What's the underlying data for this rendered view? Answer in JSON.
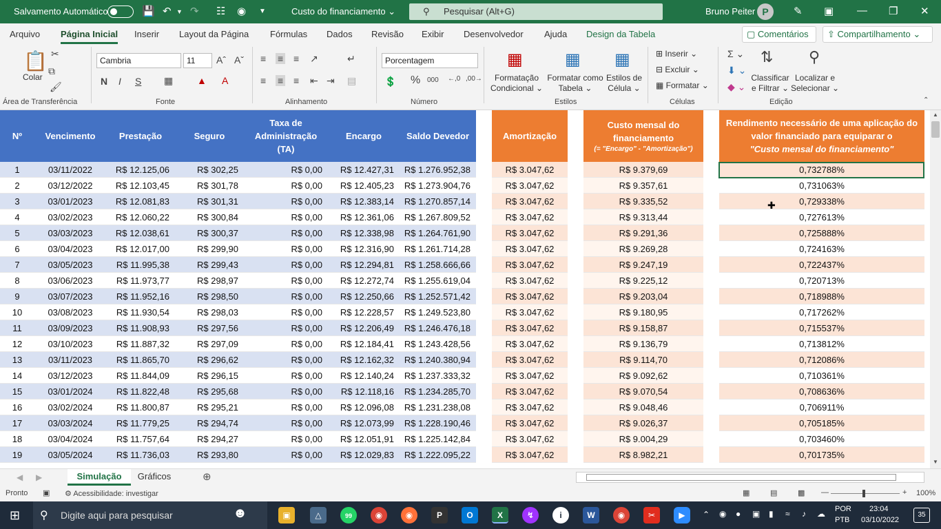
{
  "titlebar": {
    "autosave_label": "Salvamento Automático",
    "file_title": "Custo do financiamento",
    "search_placeholder": "Pesquisar (Alt+G)",
    "user_name": "Bruno Peiter",
    "avatar_initial": "P"
  },
  "menu": {
    "tabs": [
      "Arquivo",
      "Página Inicial",
      "Inserir",
      "Layout da Página",
      "Fórmulas",
      "Dados",
      "Revisão",
      "Exibir",
      "Desenvolvedor",
      "Ajuda",
      "Design da Tabela"
    ],
    "active_tab": "Página Inicial",
    "comments": "Comentários",
    "share": "Compartilhamento"
  },
  "ribbon": {
    "paste": "Colar",
    "font_name": "Cambria",
    "font_size": "11",
    "number_format": "Porcentagem",
    "cond_format": [
      "Formatação",
      "Condicional"
    ],
    "format_table": [
      "Formatar como",
      "Tabela"
    ],
    "cell_styles": [
      "Estilos de",
      "Célula"
    ],
    "insert": "Inserir",
    "delete": "Excluir",
    "format": "Formatar",
    "sort_filter": [
      "Classificar",
      "e Filtrar"
    ],
    "find_select": [
      "Localizar e",
      "Selecionar"
    ],
    "groups": [
      "Área de Transferência",
      "Fonte",
      "Alinhamento",
      "Número",
      "Estilos",
      "Células",
      "Edição"
    ]
  },
  "table_headers": {
    "n": "Nº",
    "vencimento": "Vencimento",
    "prestacao": "Prestação",
    "seguro": "Seguro",
    "taxa": "Taxa de Administração (TA)",
    "encargo": "Encargo",
    "saldo": "Saldo Devedor",
    "amortizacao": "Amortização",
    "custo": "Custo mensal do financiamento",
    "custo_note": "(= \"Encargo\" - \"Amortização\")",
    "rendimento": "Rendimento necessário de uma aplicação do valor financiado para equiparar o",
    "rendimento_italic": "\"Custo mensal do financiamento\""
  },
  "rows": [
    [
      "1",
      "03/11/2022",
      "R$ 12.125,06",
      "R$ 302,25",
      "R$ 0,00",
      "R$ 12.427,31",
      "R$ 1.276.952,38",
      "R$ 3.047,62",
      "R$ 9.379,69",
      "0,732788%"
    ],
    [
      "2",
      "03/12/2022",
      "R$ 12.103,45",
      "R$ 301,78",
      "R$ 0,00",
      "R$ 12.405,23",
      "R$ 1.273.904,76",
      "R$ 3.047,62",
      "R$ 9.357,61",
      "0,731063%"
    ],
    [
      "3",
      "03/01/2023",
      "R$ 12.081,83",
      "R$ 301,31",
      "R$ 0,00",
      "R$ 12.383,14",
      "R$ 1.270.857,14",
      "R$ 3.047,62",
      "R$ 9.335,52",
      "0,729338%"
    ],
    [
      "4",
      "03/02/2023",
      "R$ 12.060,22",
      "R$ 300,84",
      "R$ 0,00",
      "R$ 12.361,06",
      "R$ 1.267.809,52",
      "R$ 3.047,62",
      "R$ 9.313,44",
      "0,727613%"
    ],
    [
      "5",
      "03/03/2023",
      "R$ 12.038,61",
      "R$ 300,37",
      "R$ 0,00",
      "R$ 12.338,98",
      "R$ 1.264.761,90",
      "R$ 3.047,62",
      "R$ 9.291,36",
      "0,725888%"
    ],
    [
      "6",
      "03/04/2023",
      "R$ 12.017,00",
      "R$ 299,90",
      "R$ 0,00",
      "R$ 12.316,90",
      "R$ 1.261.714,28",
      "R$ 3.047,62",
      "R$ 9.269,28",
      "0,724163%"
    ],
    [
      "7",
      "03/05/2023",
      "R$ 11.995,38",
      "R$ 299,43",
      "R$ 0,00",
      "R$ 12.294,81",
      "R$ 1.258.666,66",
      "R$ 3.047,62",
      "R$ 9.247,19",
      "0,722437%"
    ],
    [
      "8",
      "03/06/2023",
      "R$ 11.973,77",
      "R$ 298,97",
      "R$ 0,00",
      "R$ 12.272,74",
      "R$ 1.255.619,04",
      "R$ 3.047,62",
      "R$ 9.225,12",
      "0,720713%"
    ],
    [
      "9",
      "03/07/2023",
      "R$ 11.952,16",
      "R$ 298,50",
      "R$ 0,00",
      "R$ 12.250,66",
      "R$ 1.252.571,42",
      "R$ 3.047,62",
      "R$ 9.203,04",
      "0,718988%"
    ],
    [
      "10",
      "03/08/2023",
      "R$ 11.930,54",
      "R$ 298,03",
      "R$ 0,00",
      "R$ 12.228,57",
      "R$ 1.249.523,80",
      "R$ 3.047,62",
      "R$ 9.180,95",
      "0,717262%"
    ],
    [
      "11",
      "03/09/2023",
      "R$ 11.908,93",
      "R$ 297,56",
      "R$ 0,00",
      "R$ 12.206,49",
      "R$ 1.246.476,18",
      "R$ 3.047,62",
      "R$ 9.158,87",
      "0,715537%"
    ],
    [
      "12",
      "03/10/2023",
      "R$ 11.887,32",
      "R$ 297,09",
      "R$ 0,00",
      "R$ 12.184,41",
      "R$ 1.243.428,56",
      "R$ 3.047,62",
      "R$ 9.136,79",
      "0,713812%"
    ],
    [
      "13",
      "03/11/2023",
      "R$ 11.865,70",
      "R$ 296,62",
      "R$ 0,00",
      "R$ 12.162,32",
      "R$ 1.240.380,94",
      "R$ 3.047,62",
      "R$ 9.114,70",
      "0,712086%"
    ],
    [
      "14",
      "03/12/2023",
      "R$ 11.844,09",
      "R$ 296,15",
      "R$ 0,00",
      "R$ 12.140,24",
      "R$ 1.237.333,32",
      "R$ 3.047,62",
      "R$ 9.092,62",
      "0,710361%"
    ],
    [
      "15",
      "03/01/2024",
      "R$ 11.822,48",
      "R$ 295,68",
      "R$ 0,00",
      "R$ 12.118,16",
      "R$ 1.234.285,70",
      "R$ 3.047,62",
      "R$ 9.070,54",
      "0,708636%"
    ],
    [
      "16",
      "03/02/2024",
      "R$ 11.800,87",
      "R$ 295,21",
      "R$ 0,00",
      "R$ 12.096,08",
      "R$ 1.231.238,08",
      "R$ 3.047,62",
      "R$ 9.048,46",
      "0,706911%"
    ],
    [
      "17",
      "03/03/2024",
      "R$ 11.779,25",
      "R$ 294,74",
      "R$ 0,00",
      "R$ 12.073,99",
      "R$ 1.228.190,46",
      "R$ 3.047,62",
      "R$ 9.026,37",
      "0,705185%"
    ],
    [
      "18",
      "03/04/2024",
      "R$ 11.757,64",
      "R$ 294,27",
      "R$ 0,00",
      "R$ 12.051,91",
      "R$ 1.225.142,84",
      "R$ 3.047,62",
      "R$ 9.004,29",
      "0,703460%"
    ],
    [
      "19",
      "03/05/2024",
      "R$ 11.736,03",
      "R$ 293,80",
      "R$ 0,00",
      "R$ 12.029,83",
      "R$ 1.222.095,22",
      "R$ 3.047,62",
      "R$ 8.982,21",
      "0,701735%"
    ]
  ],
  "sheet_tabs": [
    "Simulação",
    "Gráficos"
  ],
  "active_sheet": "Simulação",
  "status": {
    "ready": "Pronto",
    "accessibility": "Acessibilidade: investigar",
    "zoom": "100%"
  },
  "taskbar": {
    "search_placeholder": "Digite aqui para pesquisar",
    "lang1": "POR",
    "lang2": "PTB",
    "time": "23:04",
    "date": "03/10/2022",
    "notif_count": "35",
    "whatsapp_badge": "99"
  },
  "colors": {
    "excel_green": "#217346",
    "header_blue": "#4472c4",
    "header_orange": "#ed7d31",
    "band_blue": "#d9e1f2",
    "band_orange": "#fce4d6"
  }
}
